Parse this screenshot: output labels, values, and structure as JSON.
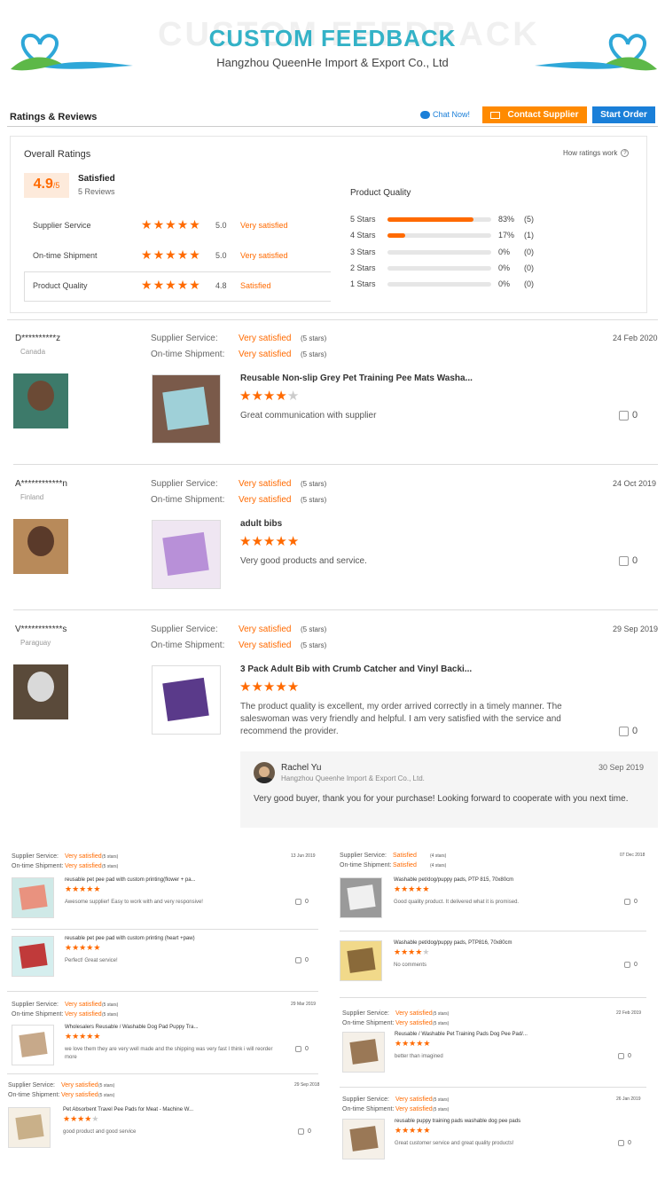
{
  "banner": {
    "ghost": "CUSTOM FEEDBACK",
    "title": "CUSTOM FEEDBACK",
    "subtitle": "Hangzhou QueenHe Import & Export Co., Ltd"
  },
  "header": {
    "title": "Ratings & Reviews",
    "chat": "Chat Now!",
    "contact": "Contact Supplier",
    "start": "Start Order"
  },
  "overall": {
    "title": "Overall Ratings",
    "score": "4.9",
    "out_of": "/5",
    "status": "Satisfied",
    "reviews": "5 Reviews",
    "how": "How ratings work",
    "rows": [
      {
        "label": "Supplier Service",
        "value": "5.0",
        "text": "Very satisfied",
        "stars": 5
      },
      {
        "label": "On-time Shipment",
        "value": "5.0",
        "text": "Very satisfied",
        "stars": 5
      },
      {
        "label": "Product Quality",
        "value": "4.8",
        "text": "Satisfied",
        "stars": 5
      }
    ],
    "pq_title": "Product Quality",
    "dist": [
      {
        "label": "5 Stars",
        "pct": "83%",
        "count": "(5)",
        "fill": 0.83
      },
      {
        "label": "4 Stars",
        "pct": "17%",
        "count": "(1)",
        "fill": 0.17
      },
      {
        "label": "3 Stars",
        "pct": "0%",
        "count": "(0)",
        "fill": 0
      },
      {
        "label": "2 Stars",
        "pct": "0%",
        "count": "(0)",
        "fill": 0
      },
      {
        "label": "1 Stars",
        "pct": "0%",
        "count": "(0)",
        "fill": 0
      }
    ]
  },
  "labels": {
    "supplier_service": "Supplier Service:",
    "ontime": "On-time Shipment:",
    "five_stars": "(5 stars)",
    "four_stars": "(4 stars)"
  },
  "reviews": [
    {
      "name": "D**********z",
      "country": "Canada",
      "ss": "Very satisfied",
      "os": "Very satisfied",
      "date": "24 Feb 2020",
      "product": "Reusable Non-slip Grey Pet Training Pee Mats Washa...",
      "stars": 4,
      "comment": "Great communication with supplier",
      "likes": "0"
    },
    {
      "name": "A************n",
      "country": "Finland",
      "ss": "Very satisfied",
      "os": "Very satisfied",
      "date": "24 Oct 2019",
      "product": "adult bibs",
      "stars": 5,
      "comment": "Very good products and service.",
      "likes": "0"
    },
    {
      "name": "V************s",
      "country": "Paraguay",
      "ss": "Very satisfied",
      "os": "Very satisfied",
      "date": "29 Sep 2019",
      "product": "3 Pack Adult Bib with Crumb Catcher and Vinyl Backi...",
      "stars": 5,
      "comment": "The product quality is excellent, my order arrived correctly in a timely manner. The saleswoman was very friendly and helpful. I am very satisfied with the service and recommend the provider.",
      "likes": "0"
    }
  ],
  "reply": {
    "name": "Rachel Yu",
    "company": "Hangzhou Queenhe Import & Export Co., Ltd.",
    "date": "30 Sep 2019",
    "text": "Very good buyer, thank you for your purchase! Looking forward to cooperate with you next time."
  },
  "small_reviews": {
    "l1": {
      "ss": "Very satisfied",
      "os": "Very satisfied",
      "date": "13 Jun 2019",
      "items": [
        {
          "product": "reusable pet pee pad with custom printing(flower + pa...",
          "comment": "Awesome supplier! Easy to work with and very responsive!",
          "stars": 5,
          "likes": "0"
        },
        {
          "product": "reusable pet pee pad with custom printing (heart +paw)",
          "comment": "Perfect! Great service!",
          "stars": 5,
          "likes": "0"
        }
      ]
    },
    "l2": {
      "ss": "Very satisfied",
      "os": "Very satisfied",
      "date": "29 Mar 2019",
      "product": "Wholesalers Reusable / Washable Dog Pad Puppy Tra...",
      "comment": "we love them they are very well made and the shipping was very fast I think i will reorder more",
      "stars": 5,
      "likes": "0"
    },
    "l3": {
      "ss": "Very satisfied",
      "os": "Very satisfied",
      "date": "29 Sep 2018",
      "product": "Pet Absorbent Travel Pee Pads for Meat - Machine W...",
      "comment": "good product and good service",
      "stars": 4,
      "likes": "0"
    },
    "r1": {
      "ss": "Satisfied",
      "os": "Satisfied",
      "date": "07 Dec 2018",
      "items": [
        {
          "product": "Washable pet/dog/puppy pads, PTP 815, 70x80cm",
          "comment": "Good quality product. It delivered what it is promised.",
          "stars": 5,
          "likes": "0"
        },
        {
          "product": "Washable pet/dog/puppy pads, PTP816, 70x80cm",
          "comment": "No comments",
          "stars": 4,
          "likes": "0"
        }
      ]
    },
    "r2": {
      "ss": "Very satisfied",
      "os": "Very satisfied",
      "date": "22 Feb 2019",
      "product": "Reusable / Washable Pet Training Pads Dog Pee Pad/...",
      "comment": "better than imagined",
      "stars": 5,
      "likes": "0"
    },
    "r3": {
      "ss": "Very satisfied",
      "os": "Very satisfied",
      "date": "26 Jan 2019",
      "product": "reusable puppy training pads washable dog pee pads",
      "comment": "Great customer service and great quality products!",
      "stars": 5,
      "likes": "0"
    }
  },
  "colors": {
    "accent": "#ff6a00",
    "blue": "#1a7fd8",
    "teal": "#33b2c7"
  },
  "icons": {
    "heart_logo": "heart-leaf-icon",
    "chat": "chat-icon",
    "mail": "mail-icon",
    "help": "help-icon",
    "like": "thumbs-up-icon",
    "star": "star-icon"
  }
}
